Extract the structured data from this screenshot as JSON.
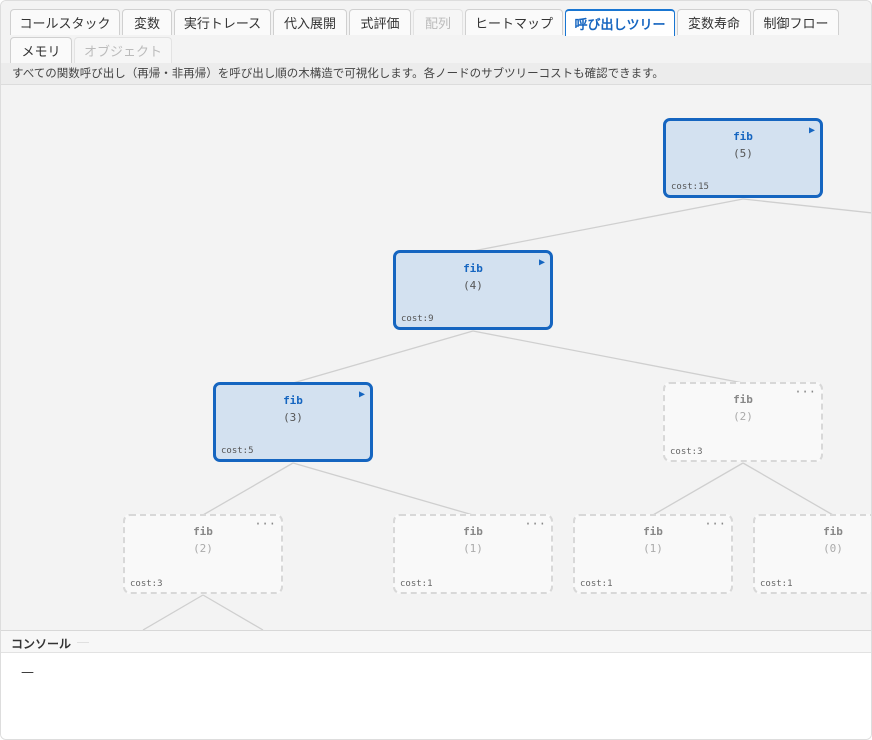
{
  "tabs": [
    {
      "label": "コールスタック",
      "state": "normal"
    },
    {
      "label": "変数",
      "state": "normal"
    },
    {
      "label": "実行トレース",
      "state": "normal"
    },
    {
      "label": "代入展開",
      "state": "normal"
    },
    {
      "label": "式評価",
      "state": "normal"
    },
    {
      "label": "配列",
      "state": "disabled"
    },
    {
      "label": "ヒートマップ",
      "state": "normal"
    },
    {
      "label": "呼び出しツリー",
      "state": "active"
    },
    {
      "label": "変数寿命",
      "state": "normal"
    },
    {
      "label": "制御フロー",
      "state": "normal"
    },
    {
      "label": "メモリ",
      "state": "normal"
    },
    {
      "label": "オブジェクト",
      "state": "disabled"
    }
  ],
  "description": "すべての関数呼び出し（再帰・非再帰）を呼び出し順の木構造で可視化します。各ノードのサブツリーコストも確認できます。",
  "tree": {
    "nodes": [
      {
        "id": "n1",
        "func": "fib",
        "args": "(5)",
        "cost": "cost:15",
        "expanded": true
      },
      {
        "id": "n2",
        "func": "fib",
        "args": "(4)",
        "cost": "cost:9",
        "expanded": true
      },
      {
        "id": "n3",
        "func": "fib",
        "args": "(3)",
        "cost": "cost:5",
        "expanded": true
      },
      {
        "id": "n4",
        "func": "fib",
        "args": "(2)",
        "cost": "cost:3",
        "expanded": false
      },
      {
        "id": "n5",
        "func": "fib",
        "args": "(2)",
        "cost": "cost:3",
        "expanded": false
      },
      {
        "id": "n6",
        "func": "fib",
        "args": "(1)",
        "cost": "cost:1",
        "expanded": false
      },
      {
        "id": "n7",
        "func": "fib",
        "args": "(1)",
        "cost": "cost:1",
        "expanded": false
      },
      {
        "id": "n8",
        "func": "fib",
        "args": "(0)",
        "cost": "cost:1",
        "expanded": false
      }
    ],
    "expand_marker": "▶",
    "collapse_marker": "···"
  },
  "console": {
    "title": "コンソール",
    "output": "—"
  }
}
